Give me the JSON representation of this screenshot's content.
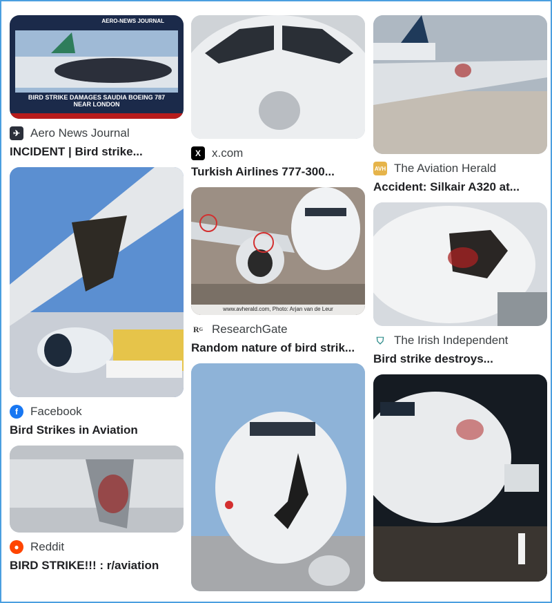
{
  "results": [
    {
      "col": 0,
      "source": "Aero News Journal",
      "icon": "aero-news-icon",
      "title": "INCIDENT | Bird strike...",
      "image_text": {
        "brand": "AERO-NEWS JOURNAL",
        "caption": "BIRD STRIKE DAMAGES SAUDIA BOEING 787 NEAR LONDON"
      }
    },
    {
      "col": 0,
      "source": "Facebook",
      "icon": "facebook-icon",
      "title": "Bird Strikes in Aviation"
    },
    {
      "col": 0,
      "source": "Reddit",
      "icon": "reddit-icon",
      "title": "BIRD STRIKE!!! : r/aviation"
    },
    {
      "col": 1,
      "source": "x.com",
      "icon": "x-icon",
      "title": "Turkish Airlines 777-300..."
    },
    {
      "col": 1,
      "source": "ResearchGate",
      "icon": "researchgate-icon",
      "title": "Random nature of bird strik...",
      "image_text": {
        "credit": "www.avherald.com, Photo: Arjan van de Leur"
      }
    },
    {
      "col": 1,
      "source": "",
      "icon": "",
      "title": ""
    },
    {
      "col": 2,
      "source": "The Aviation Herald",
      "icon": "aviation-herald-icon",
      "title": "Accident: Silkair A320 at..."
    },
    {
      "col": 2,
      "source": "The Irish Independent",
      "icon": "irish-independent-icon",
      "title": "Bird strike destroys..."
    },
    {
      "col": 2,
      "source": "",
      "icon": "",
      "title": ""
    }
  ],
  "colors": {
    "frame": "#4a9fe0",
    "facebook": "#1877f2",
    "reddit": "#ff4500"
  }
}
